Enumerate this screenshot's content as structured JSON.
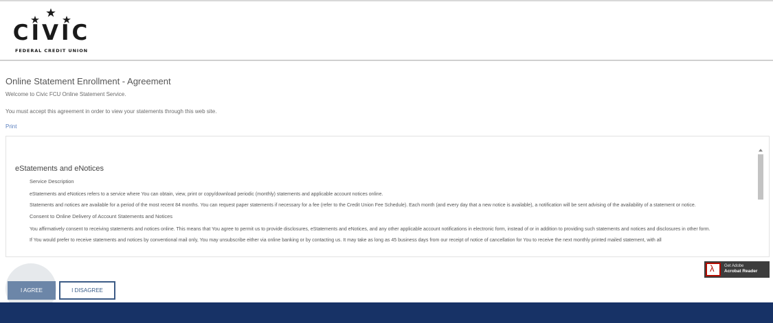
{
  "brand": {
    "name": "CIVIC",
    "subtitle": "FEDERAL CREDIT UNION"
  },
  "page": {
    "title": "Online Statement Enrollment - Agreement",
    "welcome": "Welcome to Civic FCU Online Statement Service.",
    "must_accept": "You must accept this agreement in order to view your statements through this web site.",
    "print_label": "Print"
  },
  "agreement": {
    "heading": "eStatements and eNotices",
    "sections": [
      {
        "kind": "sub",
        "text": "Service Description"
      },
      {
        "kind": "para",
        "text": "eStatements and eNotices refers to a service where You can obtain, view, print or copy/download periodic (monthly) statements and applicable account notices online."
      },
      {
        "kind": "para",
        "text": "Statements and notices are available for a period of the most recent 84 months. You can request paper statements if necessary for a fee (refer to the Credit Union Fee Schedule). Each month (and every day that a new notice is available), a notification will be sent advising of the availability of a statement or notice."
      },
      {
        "kind": "sub",
        "text": "Consent to Online Delivery of Account Statements and Notices"
      },
      {
        "kind": "para",
        "text": "You affirmatively consent to receiving statements and notices online. This means that You agree to permit us to provide disclosures, eStatements and eNotices, and any other applicable account notifications in electronic form, instead of or in addition to providing such statements and notices and disclosures in other form."
      },
      {
        "kind": "para",
        "text": "If You would prefer to receive statements and notices by conventional mail only, You may unsubscribe either via online banking or by contacting us. It may take as long as 45 business days from our receipt of notice of cancellation for You to receive the next monthly printed mailed statement, with all"
      }
    ]
  },
  "adobe": {
    "line1": "Get Adobe",
    "line2": "Acrobat Reader"
  },
  "buttons": {
    "agree": "I AGREE",
    "disagree": "I DISAGREE"
  },
  "colors": {
    "footer": "#173266",
    "agree_button": "#6c86a8",
    "link": "#5a7fbf"
  }
}
